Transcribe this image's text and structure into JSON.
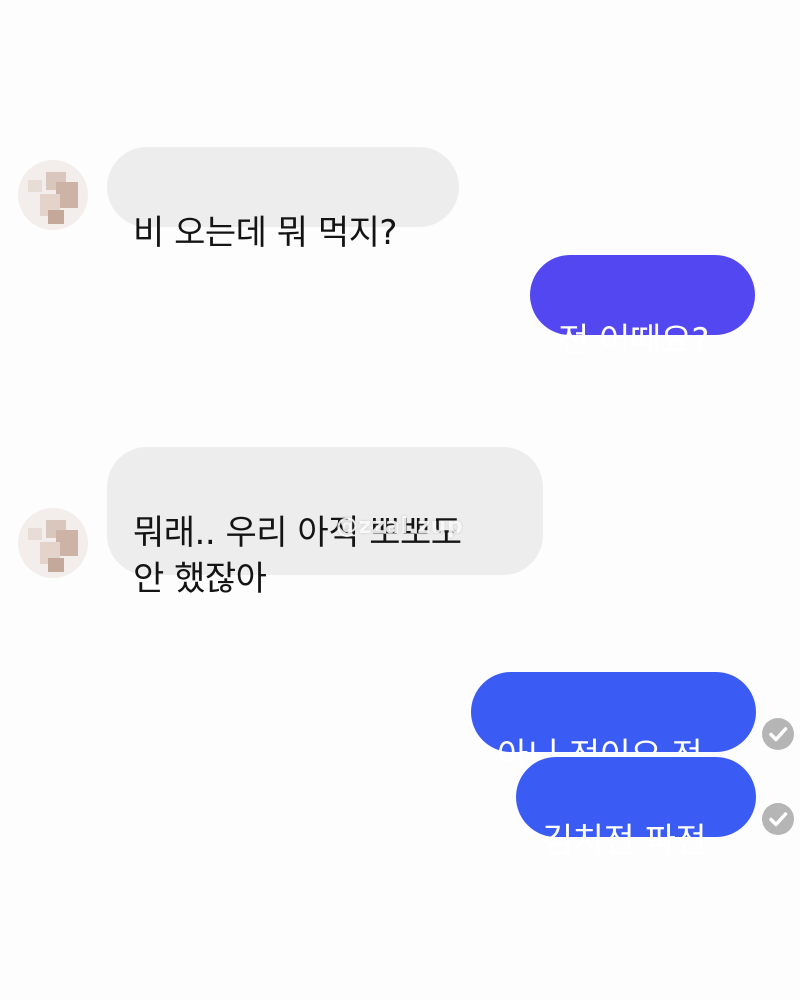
{
  "messages": [
    {
      "id": "m1",
      "side": "incoming",
      "text": "비 오는데 뭐 먹지?"
    },
    {
      "id": "m2",
      "side": "outgoing",
      "text": "전 어때요?"
    },
    {
      "id": "m3",
      "side": "incoming",
      "text": "뭐래.. 우리 아직 뽀뽀도\n안 했잖아"
    },
    {
      "id": "m4",
      "side": "outgoing",
      "text": "아니 전이요 전",
      "read": true
    },
    {
      "id": "m5",
      "side": "outgoing",
      "text": "김치전 파전",
      "read": true
    }
  ],
  "watermark": "@zzal.zup",
  "colors": {
    "incoming_bubble": "#ededed",
    "outgoing_bubble": "#3b5cf4",
    "outgoing_bubble_first": "#5247f0",
    "read_check": "#b5b5b5",
    "background": "#fdfdfd"
  },
  "icons": {
    "avatar": "blurred-avatar-icon",
    "read_receipt": "checkmark-circle-icon"
  }
}
